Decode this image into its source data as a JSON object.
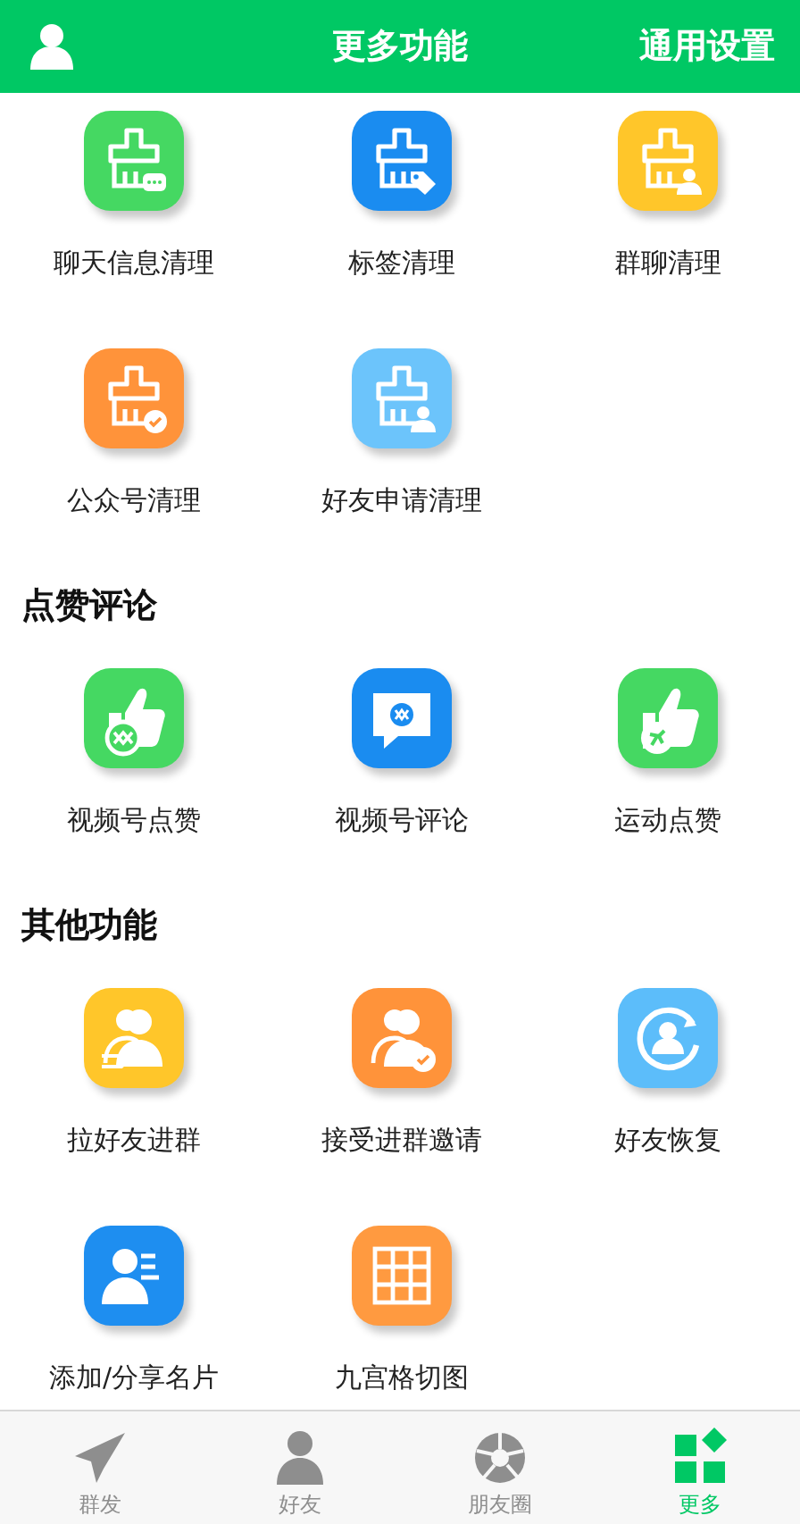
{
  "header": {
    "title": "更多功能",
    "action": "通用设置"
  },
  "sections": [
    {
      "items": [
        {
          "label": "聊天信息清理",
          "kind": "broom-chat",
          "color": "#45d862"
        },
        {
          "label": "标签清理",
          "kind": "broom-tag",
          "color": "#1a8cf0"
        },
        {
          "label": "群聊清理",
          "kind": "broom-person",
          "color": "#ffc62a"
        },
        {
          "label": "公众号清理",
          "kind": "broom-check",
          "color": "#ff933a"
        },
        {
          "label": "好友申请清理",
          "kind": "broom-person",
          "color": "#6cc4fb"
        }
      ]
    },
    {
      "title": "点赞评论",
      "items": [
        {
          "label": "视频号点赞",
          "kind": "thumb-channel",
          "color": "#45d862"
        },
        {
          "label": "视频号评论",
          "kind": "chat-channel",
          "color": "#1a8cf0"
        },
        {
          "label": "运动点赞",
          "kind": "thumb-run",
          "color": "#45d862"
        }
      ]
    },
    {
      "title": "其他功能",
      "items": [
        {
          "label": "拉好友进群",
          "kind": "people-arrow",
          "color": "#ffc62a"
        },
        {
          "label": "接受进群邀请",
          "kind": "people-check",
          "color": "#ff933a"
        },
        {
          "label": "好友恢复",
          "kind": "person-refresh",
          "color": "#5cbdfa"
        },
        {
          "label": "添加/分享名片",
          "kind": "contact-card",
          "color": "#1e8ef0"
        },
        {
          "label": "九宫格切图",
          "kind": "grid",
          "color": "#ff9a40"
        }
      ]
    }
  ],
  "tabs": [
    {
      "label": "群发",
      "kind": "send",
      "selected": false
    },
    {
      "label": "好友",
      "kind": "person",
      "selected": false
    },
    {
      "label": "朋友圈",
      "kind": "aperture",
      "selected": false
    },
    {
      "label": "更多",
      "kind": "blocks",
      "selected": true
    }
  ]
}
